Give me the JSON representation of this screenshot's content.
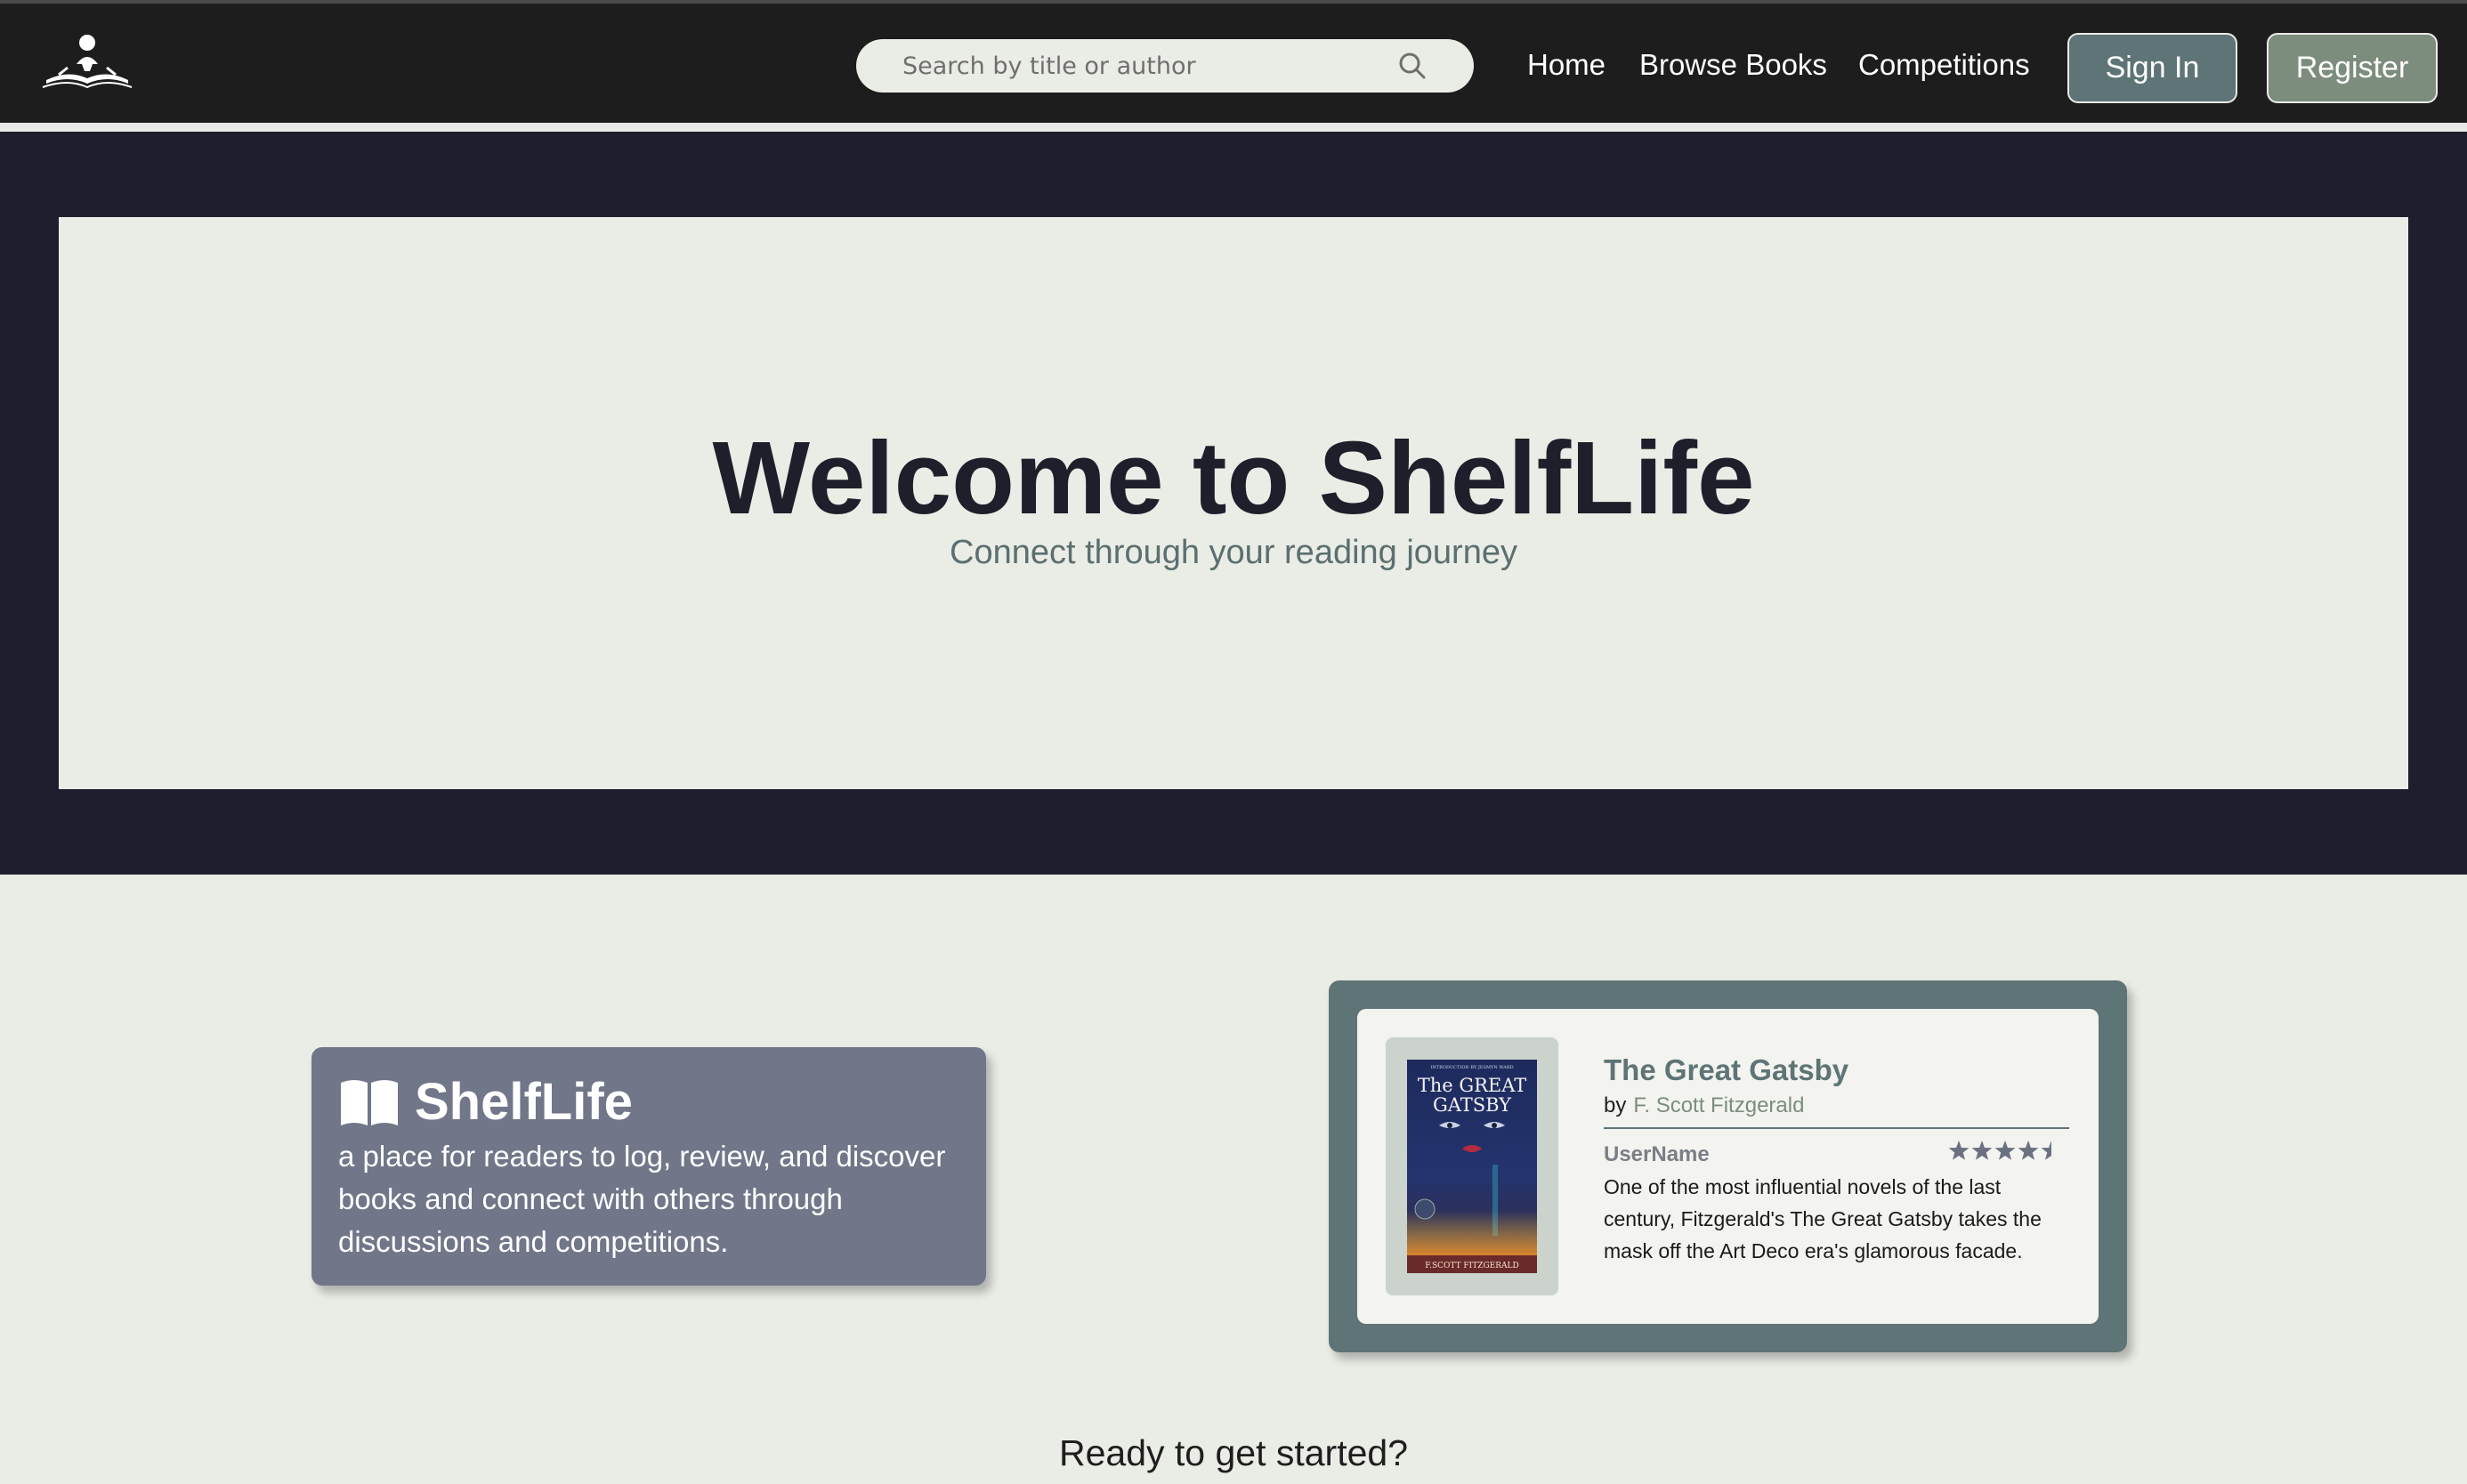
{
  "navbar": {
    "search_placeholder": "Search by title or author",
    "links": [
      "Home",
      "Browse Books",
      "Competitions"
    ],
    "sign_in_label": "Sign In",
    "register_label": "Register"
  },
  "hero": {
    "title": "Welcome to ShelfLife",
    "subtitle": "Connect through your reading journey"
  },
  "info_card": {
    "title": "ShelfLife",
    "text": "a place for readers to log, review, and discover books and connect with others through discussions and competitions."
  },
  "review_card": {
    "book_title": "The Great Gatsby",
    "by_label": "by",
    "author": "F. Scott Fitzgerald",
    "reviewer": "UserName",
    "rating": 4.5,
    "rating_max": 5,
    "review_text": "One of the most influential novels of the last century, Fitzgerald's The Great Gatsby takes the mask off the Art Deco era's glamorous facade.",
    "cover": {
      "top_text": "INTRODUCTION BY JESMYN WARD",
      "title_line1": "The GREAT",
      "title_line2": "GATSBY",
      "author_line": "F.SCOTT FITZGERALD"
    }
  },
  "cta": {
    "text": "Ready to get started?"
  },
  "colors": {
    "navbar_bg": "#1d1d1d",
    "hero_bg": "#1e1e2e",
    "page_bg": "#eaece6",
    "accent_slate": "#5e7476",
    "accent_sage": "#7d8d7d",
    "info_card_bg": "#717689"
  },
  "icons": {
    "logo": "reader-on-book-logo",
    "search": "search-icon",
    "book": "open-book-icon",
    "rating": "star-icon"
  }
}
